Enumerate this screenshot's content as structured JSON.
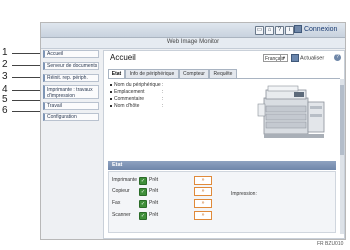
{
  "callouts": [
    "1",
    "2",
    "3",
    "4",
    "5",
    "6"
  ],
  "header": {
    "title": "Web Image Monitor",
    "connexion": "Connexion",
    "icons": [
      "monitor-icon",
      "home-icon",
      "help-icon",
      "info-icon",
      "refresh-icon"
    ]
  },
  "sidebar": {
    "items": [
      {
        "label": "Accueil"
      },
      {
        "label": "Serveur de documents"
      },
      {
        "label": "Réinit. rep. périph."
      },
      {
        "label": "Imprimante : travaux d'impression"
      },
      {
        "label": "Travail"
      },
      {
        "label": "Configuration"
      }
    ]
  },
  "main": {
    "page_title": "Accueil",
    "language": "Français",
    "refresh_label": "Actualiser",
    "help_label": "?",
    "tabs": [
      {
        "label": "Etat",
        "active": true
      },
      {
        "label": "Info de périphérique",
        "active": false
      },
      {
        "label": "Compteur",
        "active": false
      },
      {
        "label": "Requête",
        "active": false
      }
    ],
    "device_info": [
      {
        "label": "Nom du périphérique",
        "value": ":"
      },
      {
        "label": "Emplacement",
        "value": ":"
      },
      {
        "label": "Commentaire",
        "value": ":"
      },
      {
        "label": "Nom d'hôte",
        "value": ":"
      }
    ],
    "status": {
      "heading": "Etat",
      "rows": [
        {
          "label": "Imprimante",
          "state": "Prêt"
        },
        {
          "label": "Copieur",
          "state": "Prêt"
        },
        {
          "label": "Fax",
          "state": "Prêt"
        },
        {
          "label": "Scanner",
          "state": "Prêt"
        }
      ],
      "details_label": "Impression:"
    }
  },
  "figure_code": "FR BZU010"
}
